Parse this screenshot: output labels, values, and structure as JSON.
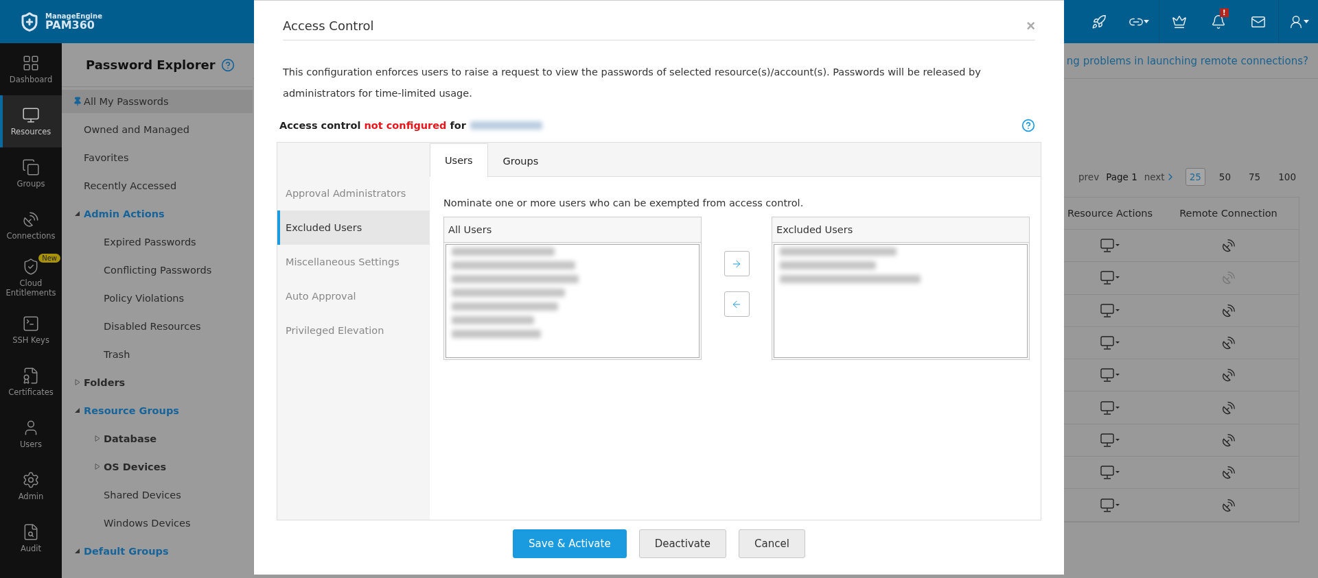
{
  "header": {
    "brand_top": "ManageEngine",
    "brand_name": "PAM360",
    "notification_badge": "!"
  },
  "rail": [
    {
      "label": "Dashboard",
      "selected": false
    },
    {
      "label": "Resources",
      "selected": true
    },
    {
      "label": "Groups",
      "selected": false
    },
    {
      "label": "Connections",
      "selected": false
    },
    {
      "label": "Cloud Entitlements",
      "selected": false,
      "badge": "New"
    },
    {
      "label": "SSH Keys",
      "selected": false
    },
    {
      "label": "Certificates",
      "selected": false
    },
    {
      "label": "Users",
      "selected": false
    },
    {
      "label": "Admin",
      "selected": false
    },
    {
      "label": "Audit",
      "selected": false
    }
  ],
  "explorer": {
    "title": "Password Explorer",
    "items": [
      {
        "label": "All My Passwords",
        "selected": true,
        "pinned": true
      },
      {
        "label": "Owned and Managed",
        "selected": false
      },
      {
        "label": "Favorites",
        "selected": false
      },
      {
        "label": "Recently Accessed",
        "selected": false
      },
      {
        "label": "Admin Actions",
        "selected": false,
        "expanded": true,
        "children": [
          {
            "label": "Expired Passwords",
            "selected": false
          },
          {
            "label": "Conflicting Passwords",
            "selected": false
          },
          {
            "label": "Policy Violations",
            "selected": false
          },
          {
            "label": "Disabled Resources",
            "selected": false
          },
          {
            "label": "Trash",
            "selected": false
          }
        ]
      },
      {
        "label": "Folders",
        "selected": false,
        "expanded": false
      },
      {
        "label": "Resource Groups",
        "selected": false,
        "expanded": true,
        "children": [
          {
            "label": "Database",
            "selected": false,
            "expanded": false
          },
          {
            "label": "OS Devices",
            "selected": false,
            "expanded": false
          },
          {
            "label": "Shared Devices",
            "selected": false
          },
          {
            "label": "Windows Devices",
            "selected": false
          }
        ]
      },
      {
        "label": "Default Groups",
        "selected": false,
        "expanded": true
      }
    ]
  },
  "content": {
    "help_link": "ng problems in launching remote connections?",
    "pagination": {
      "prev": "prev",
      "page": "Page 1",
      "next": "next",
      "sizes": [
        {
          "label": "25",
          "selected": true
        },
        {
          "label": "50",
          "selected": false
        },
        {
          "label": "75",
          "selected": false
        },
        {
          "label": "100",
          "selected": false
        }
      ]
    },
    "table": {
      "columns": [
        "Resource Actions",
        "Remote Connection"
      ],
      "rows": [
        {
          "remote_disabled": false
        },
        {
          "remote_disabled": true
        },
        {
          "remote_disabled": false
        },
        {
          "remote_disabled": false
        },
        {
          "remote_disabled": false
        },
        {
          "remote_disabled": false
        },
        {
          "remote_disabled": false
        },
        {
          "remote_disabled": false
        },
        {
          "remote_disabled": false
        }
      ]
    }
  },
  "modal": {
    "title": "Access Control",
    "close": "×",
    "description": "This configuration enforces users to raise a request to view the passwords of selected resource(s)/account(s). Passwords will be released by administrators for time-limited usage.",
    "status": {
      "prefix": "Access control",
      "value": "not configured",
      "suffix": "for"
    },
    "side_menu": [
      {
        "label": "Approval Administrators",
        "selected": false
      },
      {
        "label": "Excluded Users",
        "selected": true
      },
      {
        "label": "Miscellaneous Settings",
        "selected": false
      },
      {
        "label": "Auto Approval",
        "selected": false
      },
      {
        "label": "Privileged Elevation",
        "selected": false
      }
    ],
    "tabs": [
      {
        "label": "Users",
        "selected": true
      },
      {
        "label": "Groups",
        "selected": false
      }
    ],
    "instruction": "Nominate one or more users who can be exempted from access control.",
    "all_users": {
      "title": "All Users",
      "items": [
        {
          "kind": "redacted"
        },
        {
          "kind": "redacted"
        },
        {
          "kind": "redacted"
        },
        {
          "kind": "redacted"
        },
        {
          "kind": "redacted"
        },
        {
          "kind": "redacted"
        },
        {
          "kind": "redacted"
        }
      ]
    },
    "excluded_users": {
      "title": "Excluded Users",
      "items": [
        {
          "kind": "redacted"
        },
        {
          "kind": "redacted"
        },
        {
          "kind": "redacted"
        }
      ]
    },
    "buttons": [
      {
        "label": "Save & Activate",
        "kind": "primary"
      },
      {
        "label": "Deactivate",
        "kind": "default"
      },
      {
        "label": "Cancel",
        "kind": "default"
      }
    ]
  }
}
